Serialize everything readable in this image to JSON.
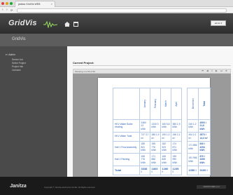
{
  "browser": {
    "tab_title": "janitza GridVis WEB",
    "tab_close": "×",
    "back": "‹",
    "forward": "›",
    "reload": "⟳",
    "url": ""
  },
  "header": {
    "app_name": "GridVis",
    "user_label": "admin ▾",
    "section_title": "GridVis"
  },
  "sidebar": {
    "root_label": "Admin",
    "items": [
      {
        "label": "Device List"
      },
      {
        "label": "Select Project"
      },
      {
        "label": "Project Info"
      },
      {
        "label": "Licenses"
      }
    ]
  },
  "content": {
    "title": "Current Project:",
    "toolbar_label": "Showing 1 to 56 of 56",
    "tools": [
      "⏮",
      "◀",
      "1",
      "▶",
      "⏭",
      "⊕"
    ]
  },
  "report": {
    "columns": [
      "January",
      "February",
      "March",
      "April",
      "December",
      "Total"
    ],
    "rows": [
      {
        "name": "HKV Water Boiler Heating",
        "values": [
          "2460 12 kWh",
          "1240 0 kWh",
          "160 5,8 kWh",
          "380 1,9 kWh",
          "240 1,2 kWh",
          "4500 l 21,6 kWh"
        ]
      },
      {
        "name": "HKV Water Total",
        "values": [
          "737 3,7 m³",
          "286 1,9 m³",
          "190 1,0 m³",
          "196 2,1 m³",
          "404 2,1 m³",
          "2873 l 14,3 m³"
        ]
      },
      {
        "name": "Hall 1 Final assembly",
        "values": [
          "189 821 kWh",
          "155 776 kWh",
          "182 923 kWh",
          "174 871 kWh",
          "171 856 kWh",
          "840 l 4254 kWh"
        ]
      },
      {
        "name": "Hall 2 Painting",
        "values": [
          "155 776 kWh",
          "171 856 kWh",
          "165 826 kWh",
          "195 990 kWh",
          "191 956 kWh",
          "870 l 4399 kWh"
        ]
      }
    ],
    "total": {
      "name": "Total",
      "values": [
        "3338 l",
        "1803 l",
        "1280 l",
        "1235 l",
        "1056 l",
        "9100 l"
      ]
    }
  },
  "footer": {
    "brand": "Janitza",
    "copyright": "Copyright © Janitza electronics GmbH. All Rights reserved.",
    "version": "GRIDVIS WEB 2.1.0"
  },
  "colors": {
    "table_text": "#2f63b5",
    "header_bg": "#3a3a3a",
    "sidebar_bg": "#4a4a4a"
  }
}
